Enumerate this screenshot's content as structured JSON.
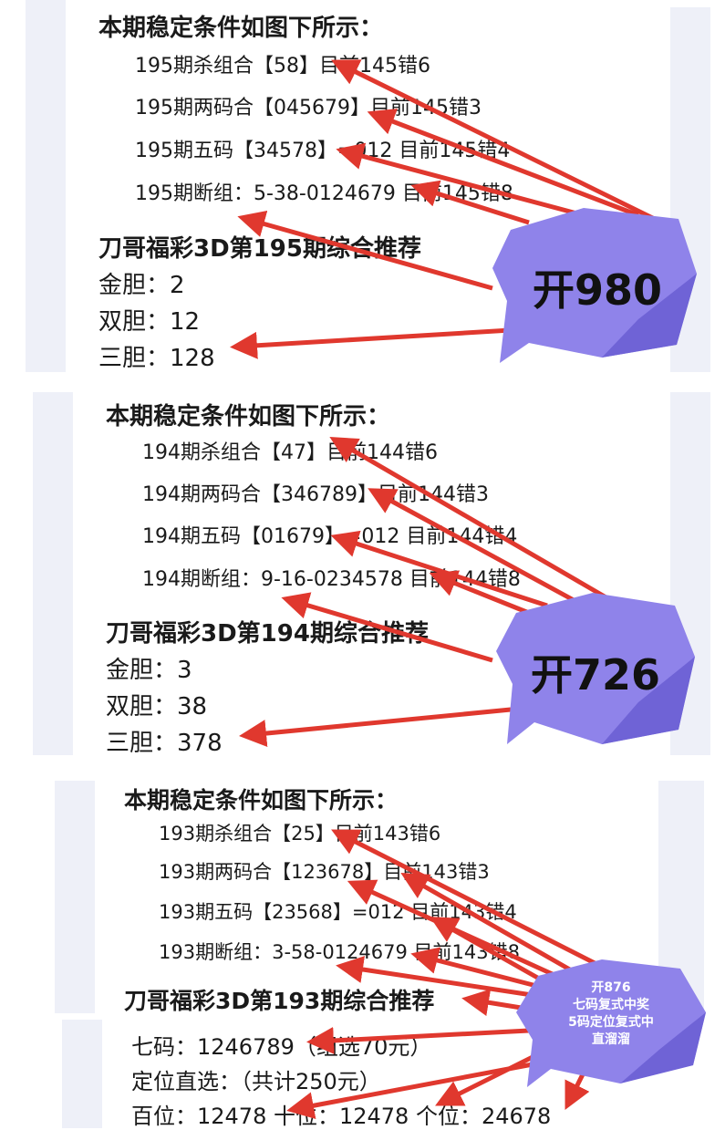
{
  "colors": {
    "arrow": "#e0382e",
    "badge": "#8f83ea",
    "badge_dark": "#6f63d6",
    "strip": "#eef0f8"
  },
  "panels": [
    {
      "heading": "本期稳定条件如图下所示：",
      "lines": [
        "195期杀组合【58】目前145错6",
        "195期两码合【045679】目前145错3",
        "195期五码【34578】=012  目前145错4",
        "195期断组：5-38-0124679 目前145错8"
      ],
      "rec_title": "刀哥福彩3D第195期综合推荐",
      "rec_lines": [
        "金胆：2",
        "双胆：12",
        "三胆：128"
      ],
      "badge": "开980"
    },
    {
      "heading": "本期稳定条件如图下所示：",
      "lines": [
        "194期杀组合【47】目前144错6",
        "194期两码合【346789】目前144错3",
        "194期五码【01679】=012  目前144错4",
        "194期断组：9-16-0234578 目前144错8"
      ],
      "rec_title": "刀哥福彩3D第194期综合推荐",
      "rec_lines": [
        "金胆：3",
        "双胆：38",
        "三胆：378"
      ],
      "badge": "开726"
    },
    {
      "heading": "本期稳定条件如图下所示：",
      "lines": [
        "193期杀组合【25】目前143错6",
        "193期两码合【123678】目前143错3",
        "193期五码【23568】=012  目前143错4",
        "193期断组：3-58-0124679 目前143错8"
      ],
      "rec_title": "刀哥福彩3D第193期综合推荐",
      "rec_lines": [
        "七码：1246789（组选70元）",
        "定位直选：（共计250元）",
        "百位：12478 十位：12478 个位：24678"
      ],
      "badge_lines": [
        "开876",
        "七码复式中奖",
        "5码定位复式中",
        "直溜溜"
      ]
    }
  ]
}
